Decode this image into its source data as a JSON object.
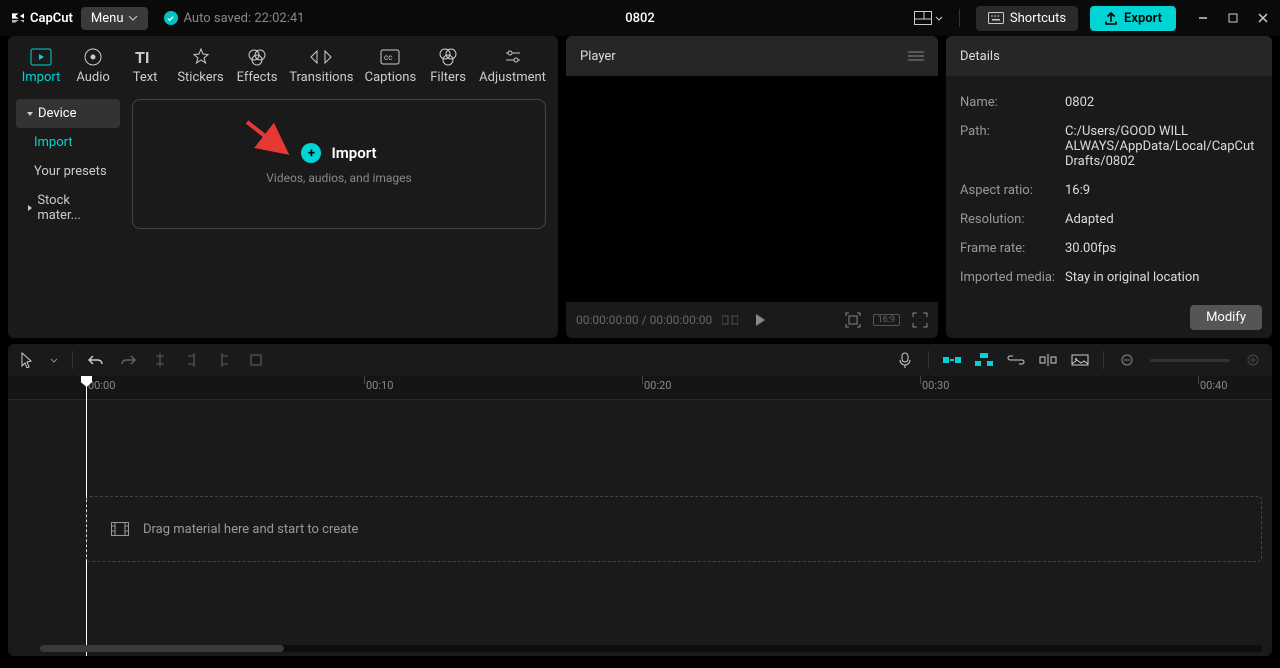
{
  "app": {
    "brand": "CapCut",
    "menu_label": "Menu",
    "autosave": "Auto saved: 22:02:41",
    "project_title": "0802",
    "shortcuts_label": "Shortcuts",
    "export_label": "Export"
  },
  "media_tabs": [
    {
      "id": "import",
      "label": "Import"
    },
    {
      "id": "audio",
      "label": "Audio"
    },
    {
      "id": "text",
      "label": "Text"
    },
    {
      "id": "stickers",
      "label": "Stickers"
    },
    {
      "id": "effects",
      "label": "Effects"
    },
    {
      "id": "transitions",
      "label": "Transitions"
    },
    {
      "id": "captions",
      "label": "Captions"
    },
    {
      "id": "filters",
      "label": "Filters"
    },
    {
      "id": "adjustment",
      "label": "Adjustment"
    }
  ],
  "media_side": {
    "device": "Device",
    "import": "Import",
    "presets": "Your presets",
    "stock": "Stock mater..."
  },
  "import_box": {
    "label": "Import",
    "sub": "Videos, audios, and images"
  },
  "player": {
    "title": "Player",
    "time_current": "00:00:00:00",
    "time_total": "00:00:00:00",
    "ratio_badge": "16:9"
  },
  "details": {
    "title": "Details",
    "rows": {
      "name_label": "Name:",
      "name_value": "0802",
      "path_label": "Path:",
      "path_value": "C:/Users/GOOD WILL ALWAYS/AppData/Local/CapCut Drafts/0802",
      "aspect_label": "Aspect ratio:",
      "aspect_value": "16:9",
      "res_label": "Resolution:",
      "res_value": "Adapted",
      "fps_label": "Frame rate:",
      "fps_value": "30.00fps",
      "media_label": "Imported media:",
      "media_value": "Stay in original location"
    },
    "modify": "Modify"
  },
  "timeline": {
    "marks": [
      "00:00",
      "00:10",
      "00:20",
      "00:30",
      "00:40"
    ],
    "drop_hint": "Drag material here and start to create"
  }
}
